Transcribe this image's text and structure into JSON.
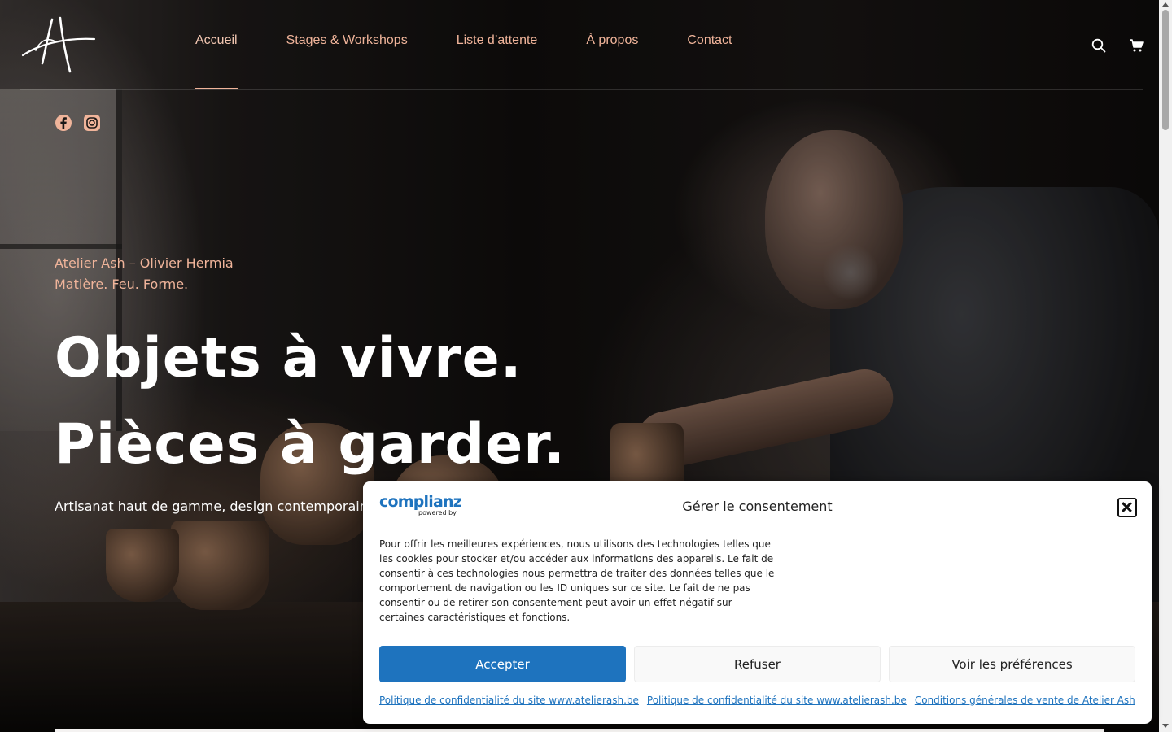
{
  "nav": {
    "items": [
      {
        "label": "Accueil",
        "active": true
      },
      {
        "label": "Stages & Workshops",
        "active": false
      },
      {
        "label": "Liste d’attente",
        "active": false
      },
      {
        "label": "À propos",
        "active": false
      },
      {
        "label": "Contact",
        "active": false
      }
    ]
  },
  "header": {
    "icons": [
      "search-icon",
      "cart-icon"
    ]
  },
  "social": {
    "icons": [
      "facebook-icon",
      "instagram-icon"
    ]
  },
  "hero": {
    "subtitle_line1": "Atelier Ash – Olivier Hermia",
    "subtitle_line2": "Matière. Feu. Forme.",
    "headline_line1": "Objets à vivre.",
    "headline_line2": "Pièces à garder.",
    "tagline": "Artisanat haut de gamme, design contemporain"
  },
  "consent": {
    "logo_text": "complianz",
    "logo_sub": "powered by",
    "title": "Gérer le consentement",
    "body": "Pour offrir les meilleures expériences, nous utilisons des technologies telles que les cookies pour stocker et/ou accéder aux informations des appareils. Le fait de consentir à ces technologies nous permettra de traiter des données telles que le comportement de navigation ou les ID uniques sur ce site. Le fait de ne pas consentir ou de retirer son consentement peut avoir un effet négatif sur certaines caractéristiques et fonctions.",
    "accept_label": "Accepter",
    "deny_label": "Refuser",
    "prefs_label": "Voir les préférences",
    "links": [
      "Politique de confidentialité du site www.atelierash.be",
      "Politique de confidentialité du site www.atelierash.be",
      "Conditions générales de vente de Atelier Ash"
    ]
  },
  "colors": {
    "accent": "#f0b49a",
    "consent_blue": "#1e73be"
  }
}
